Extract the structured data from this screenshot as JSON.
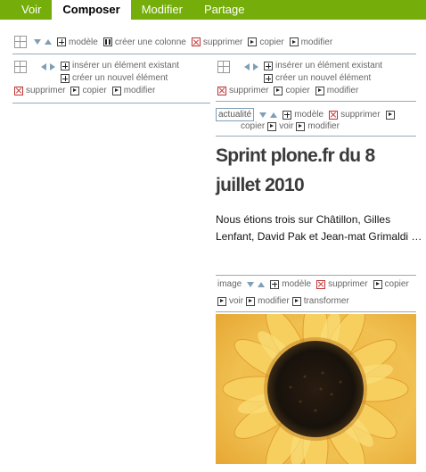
{
  "tabs": [
    {
      "label": "Voir",
      "active": false
    },
    {
      "label": "Composer",
      "active": true
    },
    {
      "label": "Modifier",
      "active": false
    },
    {
      "label": "Partage",
      "active": false
    }
  ],
  "colors": {
    "tabbar": "#75ad0a",
    "arrows": "#7f9fb6",
    "rule": "#9aa9b4",
    "delete": "#cc3333"
  },
  "layout_toolbar": {
    "model": "modèle",
    "create_column": "créer une colonne",
    "delete": "supprimer",
    "copy": "copier",
    "modify": "modifier"
  },
  "left_column": {
    "insert_existing": "insérer un élément existant",
    "create_new": "créer un nouvel élément",
    "delete": "supprimer",
    "copy": "copier",
    "modify": "modifier"
  },
  "right_column": {
    "insert_existing": "insérer un élément existant",
    "create_new": "créer un nouvel élément",
    "delete": "supprimer",
    "copy": "copier",
    "modify": "modifier"
  },
  "news_item": {
    "type_label": "actualité",
    "model": "modèle",
    "delete": "supprimer",
    "copy": "copier",
    "view": "voir",
    "modify": "modifier",
    "title": "Sprint plone.fr du 8 juillet 2010",
    "description": "Nous étions trois sur Châtillon, Gilles Lenfant, David Pak et Jean-mat Grimaldi  …"
  },
  "image_item": {
    "type_label": "image",
    "model": "modèle",
    "delete": "supprimer",
    "copy": "copier",
    "view": "voir",
    "modify": "modifier",
    "transform": "transformer"
  },
  "icons": [
    "grid-icon",
    "arrow-down-icon",
    "arrow-up-icon",
    "arrow-left-icon",
    "arrow-right-icon",
    "plus-icon",
    "delete-icon",
    "link-arrow-icon",
    "column-icon"
  ]
}
